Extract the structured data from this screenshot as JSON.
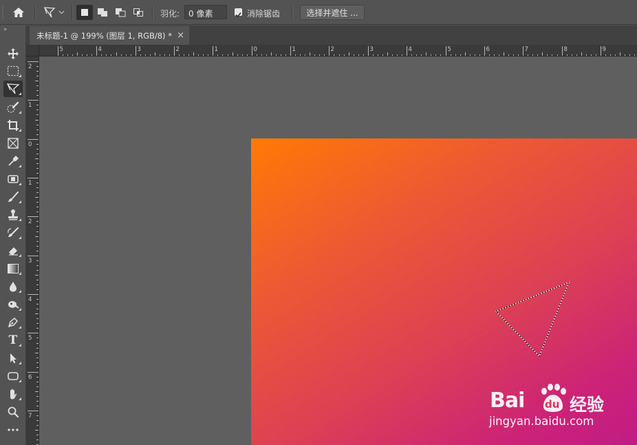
{
  "options_bar": {
    "home_icon": "home-icon",
    "tool_preset_icon": "polygonal-lasso-icon",
    "selection_modes": [
      "new-selection-icon",
      "add-to-selection-icon",
      "subtract-from-selection-icon",
      "intersect-selection-icon"
    ],
    "feather_label": "羽化:",
    "feather_value": "0 像素",
    "anti_alias_label": "消除锯齿",
    "anti_alias_checked": true,
    "select_and_mask_label": "选择并遮住 ..."
  },
  "toolbar": {
    "tools": [
      "move-icon",
      "rectangular-marquee-icon",
      "polygonal-lasso-icon",
      "quick-selection-icon",
      "crop-icon",
      "frame-icon",
      "eyedropper-icon",
      "spot-healing-icon",
      "brush-icon",
      "clone-stamp-icon",
      "history-brush-icon",
      "eraser-icon",
      "gradient-icon",
      "blur-icon",
      "dodge-icon",
      "pen-icon",
      "type-icon",
      "path-selection-icon",
      "rectangle-icon",
      "hand-icon",
      "zoom-icon",
      "more-tools-icon"
    ],
    "type_tool_glyph": "T"
  },
  "document": {
    "tab_title": "未标题-1 @ 199% (图层 1, RGB/8) *",
    "close_glyph": "×"
  },
  "rulers": {
    "horizontal_labels": [
      "5",
      "4",
      "3",
      "2",
      "1",
      "0",
      "1",
      "2",
      "3",
      "4",
      "5",
      "6",
      "7",
      "8",
      "9"
    ],
    "vertical_labels": [
      "2",
      "1",
      "0",
      "1",
      "2",
      "3",
      "4",
      "5",
      "6",
      "7"
    ]
  },
  "canvas": {
    "gradient_start": "#ff7a05",
    "gradient_end": "#c01c85",
    "pasteboard_color": "#5f5f5f"
  },
  "watermark": {
    "brand_text": "Bai",
    "brand_du": "du",
    "brand_cn": "经验",
    "url": "jingyan.baidu.com"
  }
}
